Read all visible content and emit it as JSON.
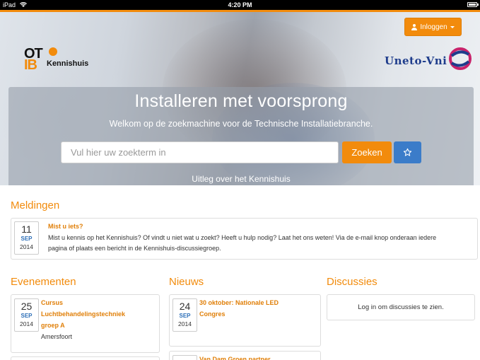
{
  "status_bar": {
    "carrier": "iPad",
    "time": "4:20 PM"
  },
  "header": {
    "login_label": "Inloggen",
    "logo_left": {
      "top": "OT",
      "bottom": "IB",
      "name": "Kennishuis"
    },
    "logo_right": {
      "name": "Uneto-Vni"
    }
  },
  "hero": {
    "title": "Installeren met voorsprong",
    "subtitle": "Welkom op de zoekmachine voor de Technische Installatiebranche.",
    "search_placeholder": "Vul hier uw zoekterm in",
    "search_button": "Zoeken",
    "star_icon": "star-icon",
    "info_link": "Uitleg over het Kennishuis"
  },
  "meldingen": {
    "heading": "Meldingen",
    "item": {
      "day": "11",
      "month": "SEP",
      "year": "2014",
      "title": "Mist u iets?",
      "line1": "Mist u kennis op het Kennishuis? Of vindt u niet wat u zoekt? Heeft u hulp nodig? Laat het ons weten! Via de e-mail knop onderaan iedere",
      "line2": "pagina of plaats een bericht in de Kennishuis-discussiegroep."
    }
  },
  "evenementen": {
    "heading": "Evenementen",
    "item": {
      "day": "25",
      "month": "SEP",
      "year": "2014",
      "title_lines": [
        "Cursus",
        "Luchtbehandelingstechniek",
        "groep A"
      ],
      "location": "Amersfoort"
    }
  },
  "nieuws": {
    "heading": "Nieuws",
    "item": {
      "day": "24",
      "month": "SEP",
      "year": "2014",
      "title_lines": [
        "30 oktober: Nationale LED",
        "Congres"
      ]
    },
    "next_item_title": "Van Dam Groen partner"
  },
  "discussies": {
    "heading": "Discussies",
    "message": "Log in om discussies te zien."
  },
  "colors": {
    "accent": "#f28b0c",
    "primary": "#3b7cc9",
    "brand_blue": "#1f3d8c"
  }
}
